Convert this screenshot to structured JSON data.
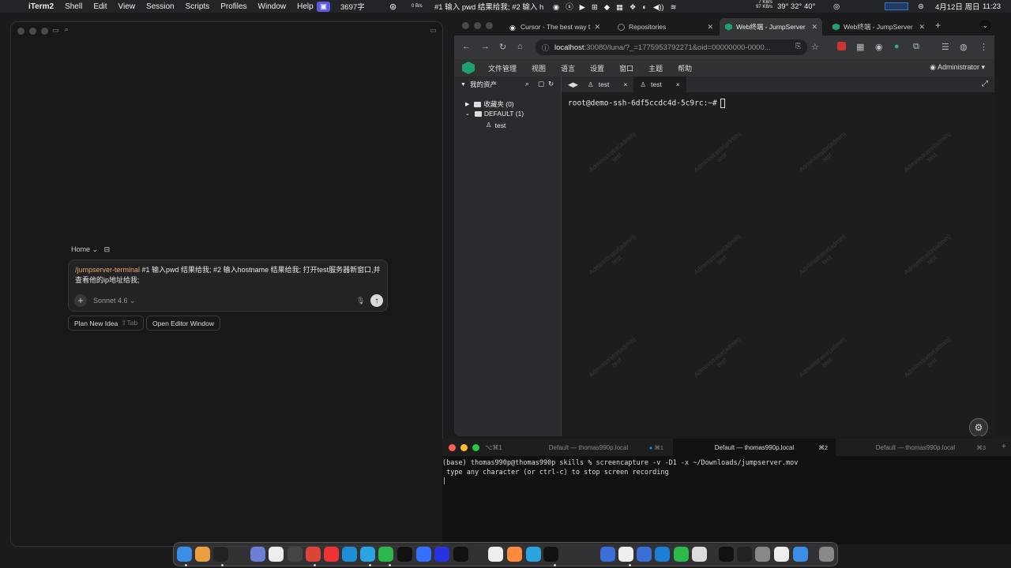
{
  "menubar": {
    "app": "iTerm2",
    "items": [
      "Shell",
      "Edit",
      "View",
      "Session",
      "Scripts",
      "Profiles",
      "Window",
      "Help"
    ],
    "word_count": "3697字",
    "net_speed": "0 B/s",
    "ticker": "#1 输入 pwd 结果给我; #2 输入 h",
    "net2_up": "7 KB/s",
    "net2_down": "97 KB/s",
    "temps": "39° 32° 40°",
    "date": "4月12日 周日",
    "time": "11:23"
  },
  "cursor": {
    "breadcrumb": "Home",
    "prompt_command": "/jumpserver-terminal",
    "prompt_text": " #1 输入pwd 结果给我; #2 输入hostname 结果给我; 打开test服务器新窗口,并查看他的ip地址给我;",
    "model": "Sonnet 4.6",
    "plan_button": "Plan New Idea",
    "plan_hint": "⇧Tab",
    "open_editor_button": "Open Editor Window"
  },
  "chrome": {
    "tabs": [
      {
        "title": "Cursor - The best way t",
        "active": false
      },
      {
        "title": "Repositories",
        "active": false
      },
      {
        "title": "Web终端 - JumpServer",
        "active": true
      },
      {
        "title": "Web终端 - JumpServer",
        "active": false
      }
    ],
    "url_host": "localhost",
    "url_rest": ":30080/luna/?_=1775953792271&oid=00000000-0000..."
  },
  "jumpserver": {
    "menu": [
      "文件管理",
      "视图",
      "语言",
      "设置",
      "窗口",
      "主题",
      "帮助"
    ],
    "user": "Administrator",
    "sidebar_title": "我的资产",
    "tree": {
      "favorites": "收藏夹 (0)",
      "default": "DEFAULT (1)",
      "asset": "test"
    },
    "term_tabs": [
      "test",
      "test"
    ],
    "prompt": "root@demo-ssh-6df5ccdc4d-5c9rc:~#",
    "watermark_line1": "Administrator(admin)",
    "watermark_line2": "test"
  },
  "iterm": {
    "tabs": [
      {
        "title": "Default — thomas990p.local",
        "shortcut": "⌘1",
        "active": false
      },
      {
        "title": "Default — thomas990p.local",
        "shortcut": "⌘2",
        "active": true
      },
      {
        "title": "Default — thomas990p.local",
        "shortcut": "⌘3",
        "active": false
      }
    ],
    "tab1_prefix": "⌥⌘1",
    "line1": "(base) thomas990p@thomas990p skills % screencapture -v -D1 -x ~/Downloads/jumpserver.mov",
    "line2": " type any character (or ctrl-c) to stop screen recording"
  },
  "colors": {
    "accent_green": "#1fa06e",
    "command_orange": "#e8a66a"
  }
}
